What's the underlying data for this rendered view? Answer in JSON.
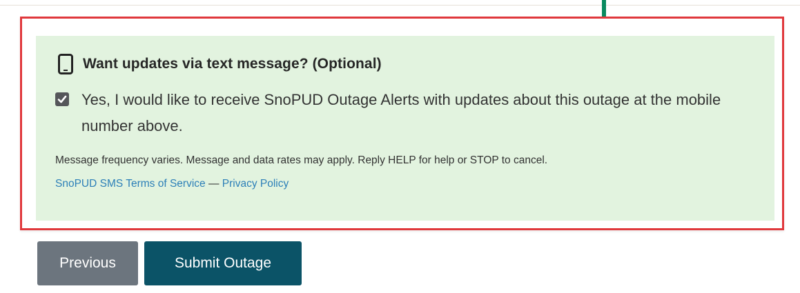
{
  "sms_optin": {
    "heading": "Want updates via text message? (Optional)",
    "consent_label": "Yes, I would like to receive SnoPUD Outage Alerts with updates about this outage at the mobile number above.",
    "consent_checked": true,
    "disclaimer": "Message frequency varies. Message and data rates may apply. Reply HELP for help or STOP to cancel.",
    "terms_link": "SnoPUD SMS Terms of Service",
    "separator": "—",
    "privacy_link": "Privacy Policy"
  },
  "buttons": {
    "previous_label": "Previous",
    "submit_label": "Submit Outage"
  },
  "icons": {
    "heading_icon": "mobile-phone-icon",
    "checkbox_icon": "checkmark-icon",
    "annotation": "down-arrow-icon"
  },
  "colors": {
    "panel_background": "#e2f3df",
    "highlight_border": "#e0383c",
    "annotation_arrow": "#0a8a5f",
    "link": "#2c7fb8",
    "previous_button": "#6c757e",
    "submit_button": "#0b5367"
  }
}
